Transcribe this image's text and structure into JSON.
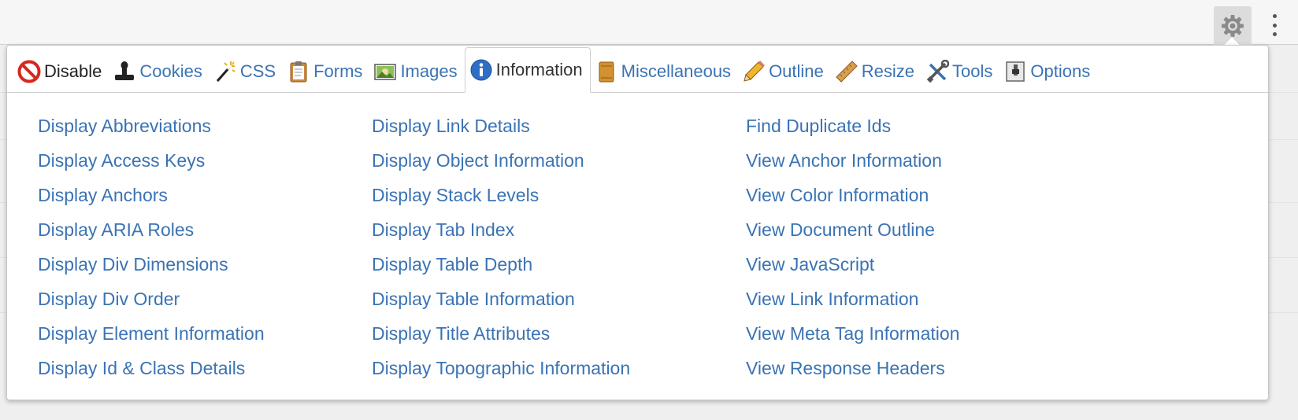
{
  "tabs": [
    {
      "label": "Disable",
      "icon": "disable-icon"
    },
    {
      "label": "Cookies",
      "icon": "cookies-icon"
    },
    {
      "label": "CSS",
      "icon": "css-wand-icon"
    },
    {
      "label": "Forms",
      "icon": "forms-clipboard-icon"
    },
    {
      "label": "Images",
      "icon": "images-icon"
    },
    {
      "label": "Information",
      "icon": "information-icon",
      "active": true
    },
    {
      "label": "Miscellaneous",
      "icon": "miscellaneous-icon"
    },
    {
      "label": "Outline",
      "icon": "outline-pencil-icon"
    },
    {
      "label": "Resize",
      "icon": "resize-ruler-icon"
    },
    {
      "label": "Tools",
      "icon": "tools-icon"
    },
    {
      "label": "Options",
      "icon": "options-icon"
    }
  ],
  "columns": [
    [
      "Display Abbreviations",
      "Display Access Keys",
      "Display Anchors",
      "Display ARIA Roles",
      "Display Div Dimensions",
      "Display Div Order",
      "Display Element Information",
      "Display Id & Class Details"
    ],
    [
      "Display Link Details",
      "Display Object Information",
      "Display Stack Levels",
      "Display Tab Index",
      "Display Table Depth",
      "Display Table Information",
      "Display Title Attributes",
      "Display Topographic Information"
    ],
    [
      "Find Duplicate Ids",
      "View Anchor Information",
      "View Color Information",
      "View Document Outline",
      "View JavaScript",
      "View Link Information",
      "View Meta Tag Information",
      "View Response Headers"
    ]
  ],
  "colors": {
    "link": "#3a73b4",
    "border": "#cfcfcf",
    "toolbar": "#f6f6f6"
  }
}
